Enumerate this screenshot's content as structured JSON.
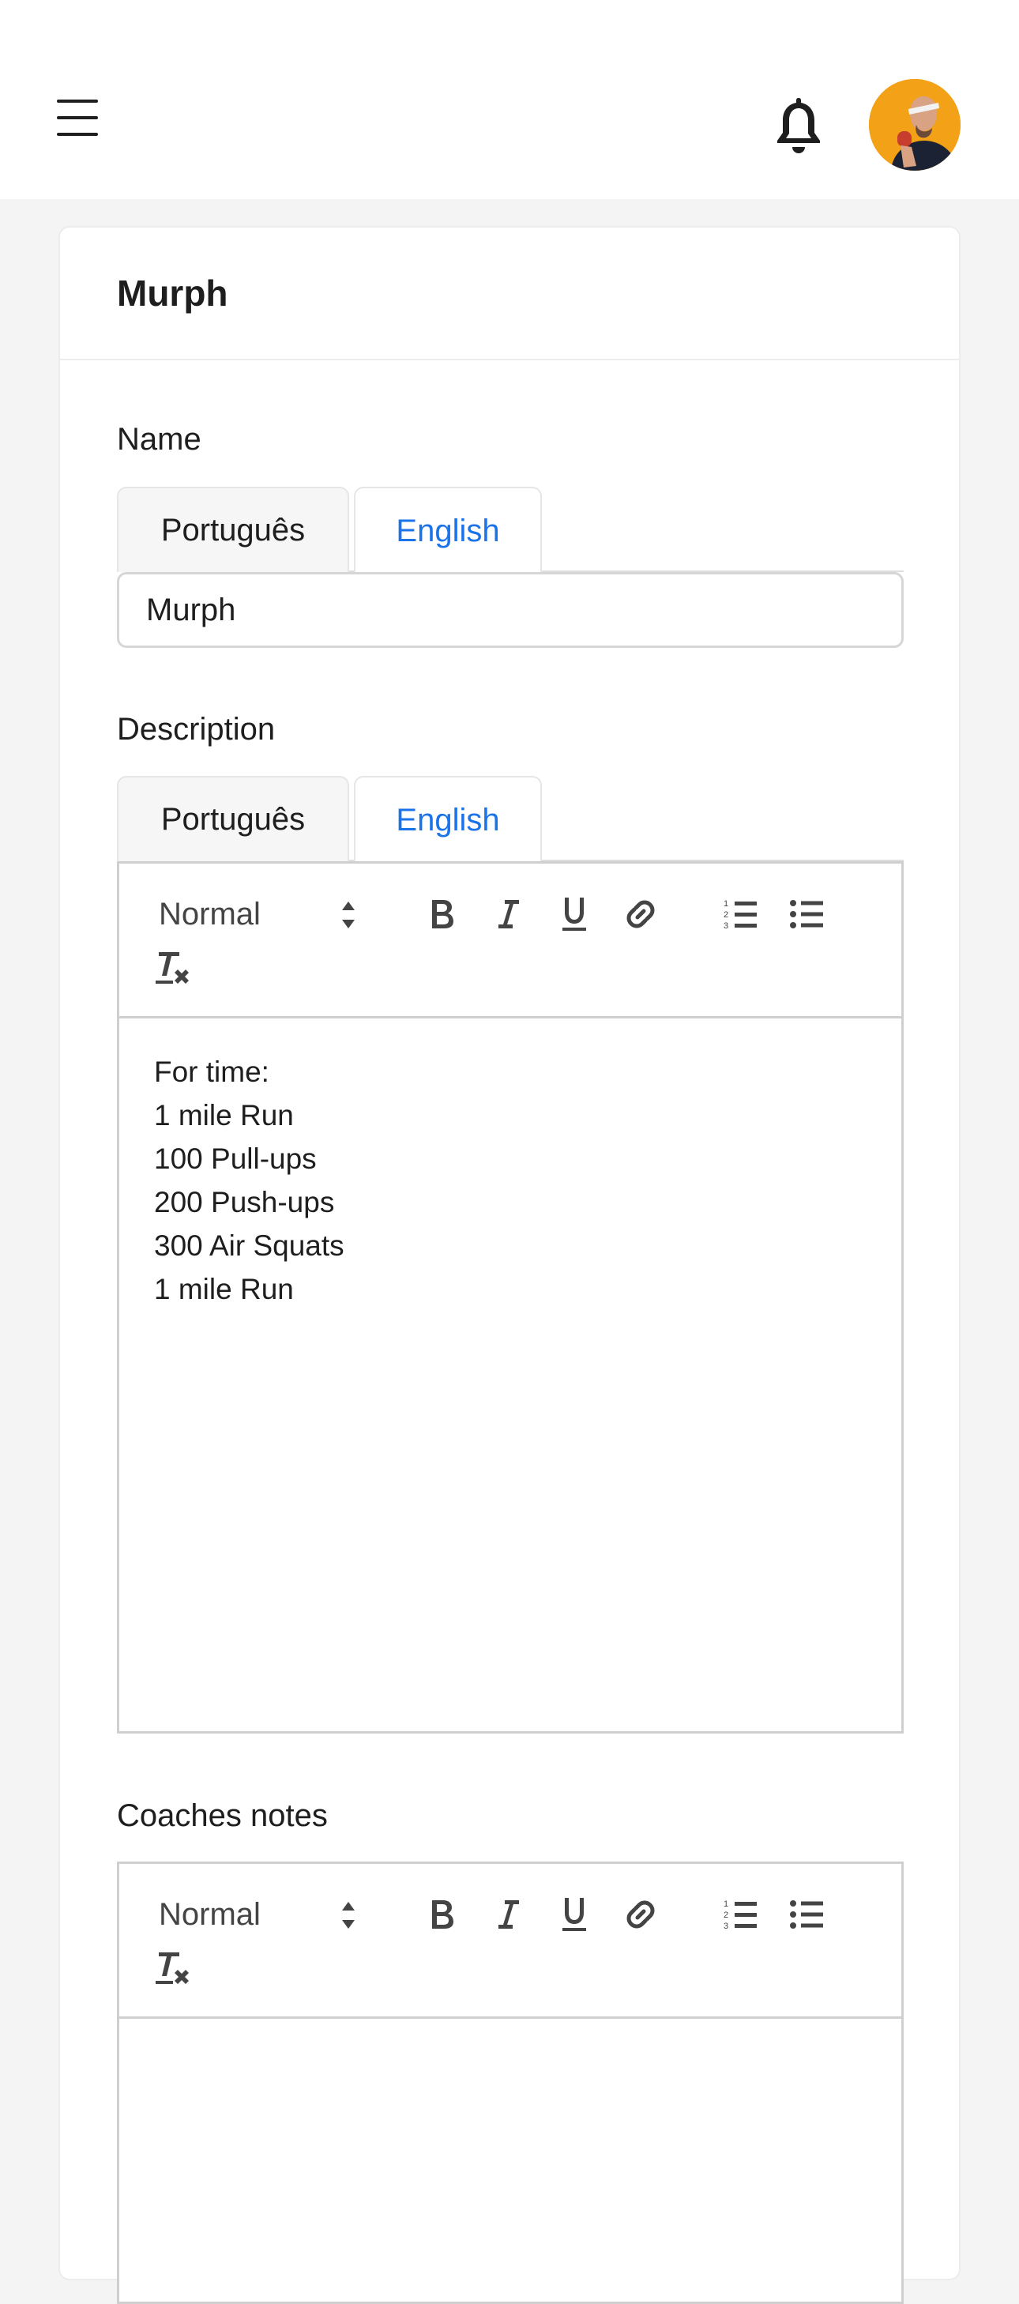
{
  "header": {
    "menu_icon": "hamburger-menu-icon",
    "notification_icon": "bell-icon",
    "avatar_icon": "user-avatar"
  },
  "card": {
    "title": "Murph"
  },
  "name_field": {
    "label": "Name",
    "tabs": [
      "Português",
      "English"
    ],
    "active_tab": "English",
    "value": "Murph"
  },
  "description_field": {
    "label": "Description",
    "tabs": [
      "Português",
      "English"
    ],
    "active_tab": "English",
    "toolbar": {
      "format_select": "Normal",
      "buttons": [
        "bold-icon",
        "italic-icon",
        "underline-icon",
        "link-icon",
        "ordered-list-icon",
        "bullet-list-icon",
        "clear-format-icon"
      ]
    },
    "content_lines": [
      "For time:",
      "1 mile Run",
      "100 Pull-ups",
      "200 Push-ups",
      "300 Air Squats",
      "1 mile Run"
    ]
  },
  "coaches_notes_field": {
    "label": "Coaches notes",
    "toolbar": {
      "format_select": "Normal",
      "buttons": [
        "bold-icon",
        "italic-icon",
        "underline-icon",
        "link-icon",
        "ordered-list-icon",
        "bullet-list-icon",
        "clear-format-icon"
      ]
    },
    "content_lines": []
  },
  "colors": {
    "accent": "#1a73e8",
    "background": "#f4f4f4",
    "avatar_bg": "#f3a116"
  }
}
